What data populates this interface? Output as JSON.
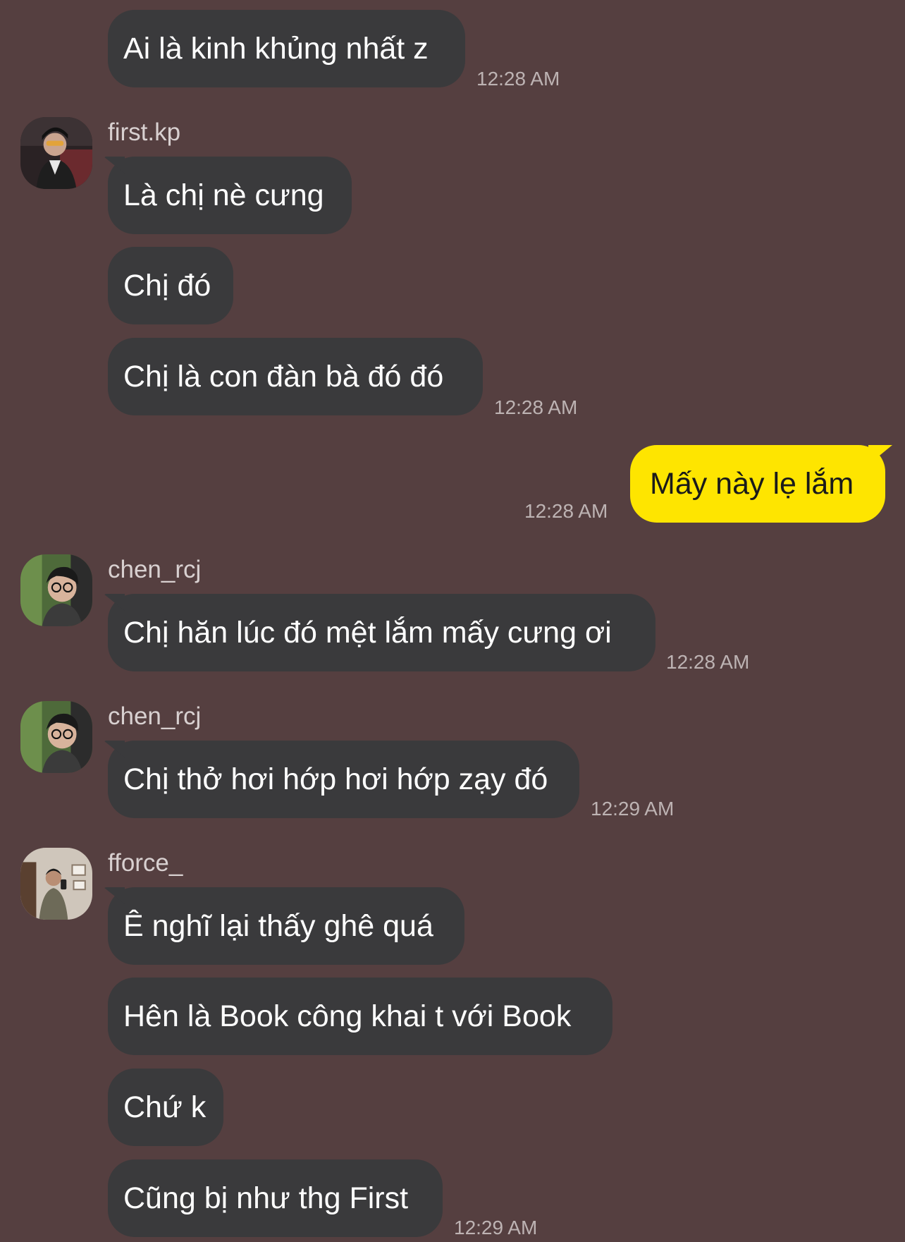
{
  "messages": [
    {
      "text": "Ai là kinh khủng nhất z",
      "time": "12:28 AM"
    },
    {
      "sender": "first.kp",
      "avatar": "avatar-first-kp"
    },
    {
      "text": "Là chị nè cưng"
    },
    {
      "text": "Chị đó"
    },
    {
      "text": "Chị là con đàn bà đó đó",
      "time": "12:28 AM"
    },
    {
      "text": "Mấy này lẹ lắm",
      "time": "12:28 AM",
      "mine": true
    },
    {
      "sender": "chen_rcj",
      "avatar": "avatar-chen-rcj"
    },
    {
      "text": "Chị hăn lúc đó mệt lắm mấy cưng ơi",
      "time": "12:28 AM"
    },
    {
      "sender": "chen_rcj",
      "avatar": "avatar-chen-rcj"
    },
    {
      "text": "Chị thở hơi hớp hơi hớp zạy đó",
      "time": "12:29 AM"
    },
    {
      "sender": "fforce_",
      "avatar": "avatar-fforce"
    },
    {
      "text": "Ê nghĩ lại thấy ghê quá"
    },
    {
      "text": "Hên là Book công khai t với Book"
    },
    {
      "text": "Chứ k"
    },
    {
      "text": "Cũng bị như thg First",
      "time": "12:29 AM"
    }
  ],
  "colors": {
    "background": "#553f40",
    "incoming_bubble": "#3a3a3c",
    "outgoing_bubble": "#fee500",
    "timestamp": "#bdb3b3"
  }
}
